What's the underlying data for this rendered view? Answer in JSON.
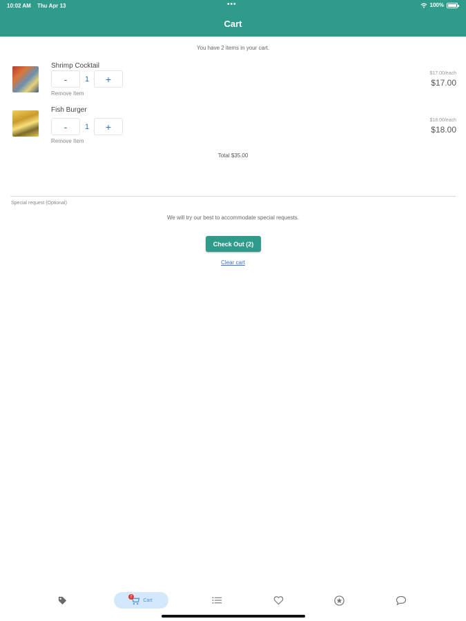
{
  "status_bar": {
    "time": "10:02 AM",
    "date": "Thu Apr 13",
    "dots": "•••",
    "battery": "100%"
  },
  "header": {
    "title": "Cart"
  },
  "cart": {
    "summary": "You have 2 items in your cart.",
    "items": [
      {
        "name": "Shrimp Cocktail",
        "quantity": "1",
        "remove_label": "Remove Item",
        "unit_price": "$17.00/each",
        "line_price": "$17.00",
        "decrement": "-",
        "increment": "+"
      },
      {
        "name": "Fish Burger",
        "quantity": "1",
        "remove_label": "Remove Item",
        "unit_price": "$18.00/each",
        "line_price": "$18.00",
        "decrement": "-",
        "increment": "+"
      }
    ],
    "total": "Total $35.00",
    "special_request_label": "Special request (Optional)",
    "special_request_note": "We will try our best to accommodate special requests.",
    "checkout_label": "Check Out (2)",
    "clear_label": "Clear cart"
  },
  "tabbar": {
    "cart_label": "Cart",
    "cart_badge": "2",
    "icons": [
      "tag-icon",
      "cart-icon",
      "list-icon",
      "heart-icon",
      "star-icon",
      "chat-icon"
    ]
  },
  "colors": {
    "primary": "#2e9b8b",
    "link": "#3b6fd6",
    "qty": "#2a6fc0",
    "cart_tab_bg": "#d3e8fb",
    "badge": "#e53935"
  }
}
